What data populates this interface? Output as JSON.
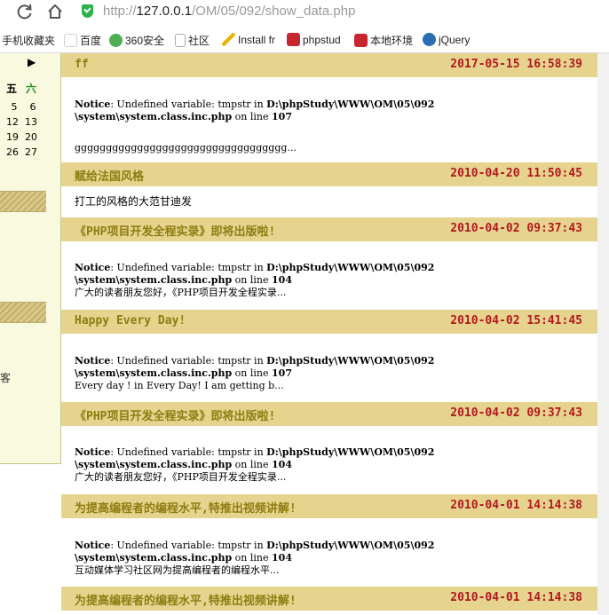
{
  "browser": {
    "url_prefix": "http://",
    "url_host": "127.0.0.1",
    "url_path": "/OM/05/092/show_data.php",
    "bookmarks": [
      "手机收藏夹",
      "百度",
      "360安全",
      "社区",
      "Install fr",
      "phpstud",
      "本地环境",
      "jQuery"
    ]
  },
  "calendar": {
    "arrow": "▶",
    "headers": [
      "五",
      "六"
    ],
    "rows": [
      [
        "5",
        "6"
      ],
      [
        "12",
        "13"
      ],
      [
        "19",
        "20"
      ],
      [
        "26",
        "27"
      ]
    ]
  },
  "sidebar_chars": [
    "",
    "客",
    "",
    ""
  ],
  "posts": [
    {
      "title": "ff",
      "date": "2017-05-15 16:58:39",
      "notice_var": "tmpstr",
      "notice_path1": "D:\\phpStudy\\WWW\\OM\\05\\092",
      "notice_path2": "\\system\\system.class.inc.php",
      "notice_line": "107",
      "excerpt": "gggggggggggggggggggggggggggggggggg..."
    },
    {
      "title": "赋给法国风格",
      "date": "2010-04-20 11:50:45",
      "excerpt": "打工的风格的大范甘迪发"
    },
    {
      "title": "《PHP项目开发全程实录》即将出版啦!",
      "date": "2010-04-02 09:37:43",
      "notice_var": "tmpstr",
      "notice_path1": "D:\\phpStudy\\WWW\\OM\\05\\092",
      "notice_path2": "\\system\\system.class.inc.php",
      "notice_line": "104",
      "excerpt": "广大的读者朋友您好，《PHP项目开发全程实录..."
    },
    {
      "title": "Happy Every Day!",
      "date": "2010-04-02 15:41:45",
      "notice_var": "tmpstr",
      "notice_path1": "D:\\phpStudy\\WWW\\OM\\05\\092",
      "notice_path2": "\\system\\system.class.inc.php",
      "notice_line": "107",
      "excerpt": "Every day ! in Every Day! I am getting b..."
    },
    {
      "title": "《PHP项目开发全程实录》即将出版啦!",
      "date": "2010-04-02 09:37:43",
      "notice_var": "tmpstr",
      "notice_path1": "D:\\phpStudy\\WWW\\OM\\05\\092",
      "notice_path2": "\\system\\system.class.inc.php",
      "notice_line": "104",
      "excerpt": "广大的读者朋友您好，《PHP项目开发全程实录..."
    },
    {
      "title": "为提高编程者的编程水平,特推出视频讲解!",
      "date": "2010-04-01 14:14:38",
      "notice_var": "tmpstr",
      "notice_path1": "D:\\phpStudy\\WWW\\OM\\05\\092",
      "notice_path2": "\\system\\system.class.inc.php",
      "notice_line": "104",
      "excerpt": "互动媒体学习社区网为提高编程者的编程水平..."
    },
    {
      "title": "为提高编程者的编程水平,特推出视频讲解!",
      "date": "2010-04-01 14:14:38"
    }
  ],
  "notice_words": {
    "notice": "Notice",
    "undefined": ": Undefined variable:",
    "in": "in",
    "on_line": "on line"
  },
  "colors": {
    "header_bg": "#e6d48e",
    "title": "#8e7d12",
    "date": "#b3181f"
  }
}
